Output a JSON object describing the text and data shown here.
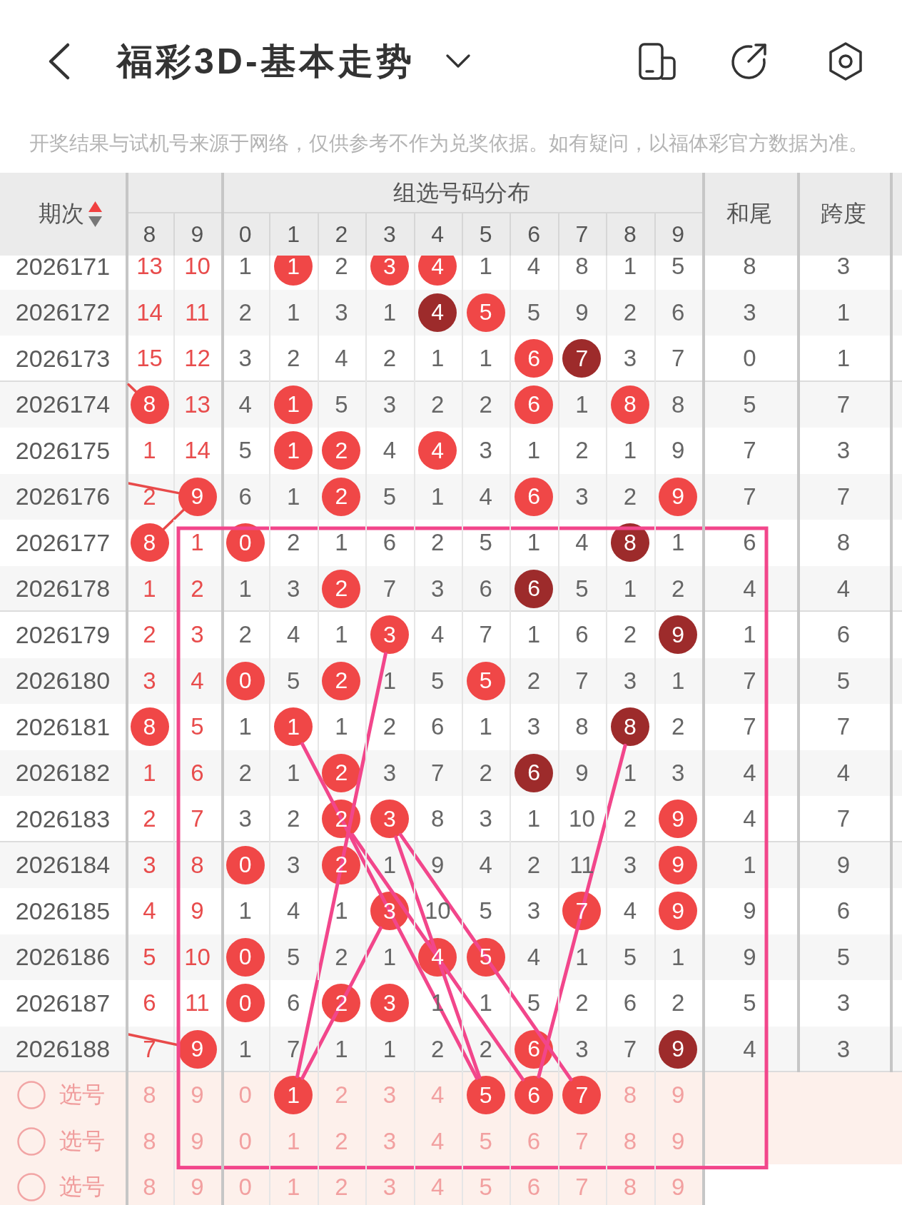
{
  "top_bar": {
    "title": "福彩3D-基本走势"
  },
  "notice": "开奖结果与试机号来源于网络，仅供参考不作为兑奖依据。如有疑问，以福体彩官方数据为准。",
  "table": {
    "period_header": "期次",
    "sort_ascending": true,
    "group_header": "组选号码分布",
    "sum_tail_header": "和尾",
    "span_header": "跨度",
    "digit_headers": [
      "8",
      "9",
      "0",
      "1",
      "2",
      "3",
      "4",
      "5",
      "6",
      "7",
      "8",
      "9"
    ],
    "rows": [
      {
        "period": "2026171",
        "cells": [
          {
            "value": "13",
            "kind": "plain"
          },
          {
            "value": "10",
            "kind": "plain"
          },
          {
            "value": "1",
            "kind": "plain"
          },
          {
            "value": "1",
            "kind": "ball"
          },
          {
            "value": "2",
            "kind": "plain"
          },
          {
            "value": "3",
            "kind": "ball"
          },
          {
            "value": "4",
            "kind": "ball"
          },
          {
            "value": "1",
            "kind": "plain"
          },
          {
            "value": "4",
            "kind": "plain"
          },
          {
            "value": "8",
            "kind": "plain"
          },
          {
            "value": "1",
            "kind": "plain"
          },
          {
            "value": "5",
            "kind": "plain"
          }
        ],
        "sum_tail": "8",
        "span": "3"
      },
      {
        "period": "2026172",
        "cells": [
          {
            "value": "14",
            "kind": "plain"
          },
          {
            "value": "11",
            "kind": "plain"
          },
          {
            "value": "2",
            "kind": "plain"
          },
          {
            "value": "1",
            "kind": "plain"
          },
          {
            "value": "3",
            "kind": "plain"
          },
          {
            "value": "1",
            "kind": "plain"
          },
          {
            "value": "4",
            "kind": "pair"
          },
          {
            "value": "5",
            "kind": "ball"
          },
          {
            "value": "5",
            "kind": "plain"
          },
          {
            "value": "9",
            "kind": "plain"
          },
          {
            "value": "2",
            "kind": "plain"
          },
          {
            "value": "6",
            "kind": "plain"
          }
        ],
        "sum_tail": "3",
        "span": "1"
      },
      {
        "period": "2026173",
        "cells": [
          {
            "value": "15",
            "kind": "plain"
          },
          {
            "value": "12",
            "kind": "plain"
          },
          {
            "value": "3",
            "kind": "plain"
          },
          {
            "value": "2",
            "kind": "plain"
          },
          {
            "value": "4",
            "kind": "plain"
          },
          {
            "value": "2",
            "kind": "plain"
          },
          {
            "value": "1",
            "kind": "plain"
          },
          {
            "value": "1",
            "kind": "plain"
          },
          {
            "value": "6",
            "kind": "ball"
          },
          {
            "value": "7",
            "kind": "pair"
          },
          {
            "value": "3",
            "kind": "plain"
          },
          {
            "value": "7",
            "kind": "plain"
          }
        ],
        "sum_tail": "0",
        "span": "1"
      },
      {
        "period": "2026174",
        "cells": [
          {
            "value": "8",
            "kind": "ball"
          },
          {
            "value": "13",
            "kind": "plain"
          },
          {
            "value": "4",
            "kind": "plain"
          },
          {
            "value": "1",
            "kind": "ball"
          },
          {
            "value": "5",
            "kind": "plain"
          },
          {
            "value": "3",
            "kind": "plain"
          },
          {
            "value": "2",
            "kind": "plain"
          },
          {
            "value": "2",
            "kind": "plain"
          },
          {
            "value": "6",
            "kind": "ball"
          },
          {
            "value": "1",
            "kind": "plain"
          },
          {
            "value": "8",
            "kind": "ball"
          },
          {
            "value": "8",
            "kind": "plain"
          }
        ],
        "sum_tail": "5",
        "span": "7"
      },
      {
        "period": "2026175",
        "cells": [
          {
            "value": "1",
            "kind": "plain"
          },
          {
            "value": "14",
            "kind": "plain"
          },
          {
            "value": "5",
            "kind": "plain"
          },
          {
            "value": "1",
            "kind": "ball"
          },
          {
            "value": "2",
            "kind": "ball"
          },
          {
            "value": "4",
            "kind": "plain"
          },
          {
            "value": "4",
            "kind": "ball"
          },
          {
            "value": "3",
            "kind": "plain"
          },
          {
            "value": "1",
            "kind": "plain"
          },
          {
            "value": "2",
            "kind": "plain"
          },
          {
            "value": "1",
            "kind": "plain"
          },
          {
            "value": "9",
            "kind": "plain"
          }
        ],
        "sum_tail": "7",
        "span": "3"
      },
      {
        "period": "2026176",
        "cells": [
          {
            "value": "2",
            "kind": "plain"
          },
          {
            "value": "9",
            "kind": "ball"
          },
          {
            "value": "6",
            "kind": "plain"
          },
          {
            "value": "1",
            "kind": "plain"
          },
          {
            "value": "2",
            "kind": "ball"
          },
          {
            "value": "5",
            "kind": "plain"
          },
          {
            "value": "1",
            "kind": "plain"
          },
          {
            "value": "4",
            "kind": "plain"
          },
          {
            "value": "6",
            "kind": "ball"
          },
          {
            "value": "3",
            "kind": "plain"
          },
          {
            "value": "2",
            "kind": "plain"
          },
          {
            "value": "9",
            "kind": "ball"
          }
        ],
        "sum_tail": "7",
        "span": "7"
      },
      {
        "period": "2026177",
        "cells": [
          {
            "value": "8",
            "kind": "ball"
          },
          {
            "value": "1",
            "kind": "plain"
          },
          {
            "value": "0",
            "kind": "ball"
          },
          {
            "value": "2",
            "kind": "plain"
          },
          {
            "value": "1",
            "kind": "plain"
          },
          {
            "value": "6",
            "kind": "plain"
          },
          {
            "value": "2",
            "kind": "plain"
          },
          {
            "value": "5",
            "kind": "plain"
          },
          {
            "value": "1",
            "kind": "plain"
          },
          {
            "value": "4",
            "kind": "plain"
          },
          {
            "value": "8",
            "kind": "pair"
          },
          {
            "value": "1",
            "kind": "plain"
          }
        ],
        "sum_tail": "6",
        "span": "8"
      },
      {
        "period": "2026178",
        "cells": [
          {
            "value": "1",
            "kind": "plain"
          },
          {
            "value": "2",
            "kind": "plain"
          },
          {
            "value": "1",
            "kind": "plain"
          },
          {
            "value": "3",
            "kind": "plain"
          },
          {
            "value": "2",
            "kind": "ball"
          },
          {
            "value": "7",
            "kind": "plain"
          },
          {
            "value": "3",
            "kind": "plain"
          },
          {
            "value": "6",
            "kind": "plain"
          },
          {
            "value": "6",
            "kind": "pair"
          },
          {
            "value": "5",
            "kind": "plain"
          },
          {
            "value": "1",
            "kind": "plain"
          },
          {
            "value": "2",
            "kind": "plain"
          }
        ],
        "sum_tail": "4",
        "span": "4"
      },
      {
        "period": "2026179",
        "cells": [
          {
            "value": "2",
            "kind": "plain"
          },
          {
            "value": "3",
            "kind": "plain"
          },
          {
            "value": "2",
            "kind": "plain"
          },
          {
            "value": "4",
            "kind": "plain"
          },
          {
            "value": "1",
            "kind": "plain"
          },
          {
            "value": "3",
            "kind": "ball"
          },
          {
            "value": "4",
            "kind": "plain"
          },
          {
            "value": "7",
            "kind": "plain"
          },
          {
            "value": "1",
            "kind": "plain"
          },
          {
            "value": "6",
            "kind": "plain"
          },
          {
            "value": "2",
            "kind": "plain"
          },
          {
            "value": "9",
            "kind": "pair"
          }
        ],
        "sum_tail": "1",
        "span": "6"
      },
      {
        "period": "2026180",
        "cells": [
          {
            "value": "3",
            "kind": "plain"
          },
          {
            "value": "4",
            "kind": "plain"
          },
          {
            "value": "0",
            "kind": "ball"
          },
          {
            "value": "5",
            "kind": "plain"
          },
          {
            "value": "2",
            "kind": "ball"
          },
          {
            "value": "1",
            "kind": "plain"
          },
          {
            "value": "5",
            "kind": "plain"
          },
          {
            "value": "5",
            "kind": "ball"
          },
          {
            "value": "2",
            "kind": "plain"
          },
          {
            "value": "7",
            "kind": "plain"
          },
          {
            "value": "3",
            "kind": "plain"
          },
          {
            "value": "1",
            "kind": "plain"
          }
        ],
        "sum_tail": "7",
        "span": "5"
      },
      {
        "period": "2026181",
        "cells": [
          {
            "value": "8",
            "kind": "ball"
          },
          {
            "value": "5",
            "kind": "plain"
          },
          {
            "value": "1",
            "kind": "plain"
          },
          {
            "value": "1",
            "kind": "ball"
          },
          {
            "value": "1",
            "kind": "plain"
          },
          {
            "value": "2",
            "kind": "plain"
          },
          {
            "value": "6",
            "kind": "plain"
          },
          {
            "value": "1",
            "kind": "plain"
          },
          {
            "value": "3",
            "kind": "plain"
          },
          {
            "value": "8",
            "kind": "plain"
          },
          {
            "value": "8",
            "kind": "pair"
          },
          {
            "value": "2",
            "kind": "plain"
          }
        ],
        "sum_tail": "7",
        "span": "7"
      },
      {
        "period": "2026182",
        "cells": [
          {
            "value": "1",
            "kind": "plain"
          },
          {
            "value": "6",
            "kind": "plain"
          },
          {
            "value": "2",
            "kind": "plain"
          },
          {
            "value": "1",
            "kind": "plain"
          },
          {
            "value": "2",
            "kind": "ball"
          },
          {
            "value": "3",
            "kind": "plain"
          },
          {
            "value": "7",
            "kind": "plain"
          },
          {
            "value": "2",
            "kind": "plain"
          },
          {
            "value": "6",
            "kind": "pair"
          },
          {
            "value": "9",
            "kind": "plain"
          },
          {
            "value": "1",
            "kind": "plain"
          },
          {
            "value": "3",
            "kind": "plain"
          }
        ],
        "sum_tail": "4",
        "span": "4"
      },
      {
        "period": "2026183",
        "cells": [
          {
            "value": "2",
            "kind": "plain"
          },
          {
            "value": "7",
            "kind": "plain"
          },
          {
            "value": "3",
            "kind": "plain"
          },
          {
            "value": "2",
            "kind": "plain"
          },
          {
            "value": "2",
            "kind": "ball"
          },
          {
            "value": "3",
            "kind": "ball"
          },
          {
            "value": "8",
            "kind": "plain"
          },
          {
            "value": "3",
            "kind": "plain"
          },
          {
            "value": "1",
            "kind": "plain"
          },
          {
            "value": "10",
            "kind": "plain"
          },
          {
            "value": "2",
            "kind": "plain"
          },
          {
            "value": "9",
            "kind": "ball"
          }
        ],
        "sum_tail": "4",
        "span": "7"
      },
      {
        "period": "2026184",
        "cells": [
          {
            "value": "3",
            "kind": "plain"
          },
          {
            "value": "8",
            "kind": "plain"
          },
          {
            "value": "0",
            "kind": "ball"
          },
          {
            "value": "3",
            "kind": "plain"
          },
          {
            "value": "2",
            "kind": "ball"
          },
          {
            "value": "1",
            "kind": "plain"
          },
          {
            "value": "9",
            "kind": "plain"
          },
          {
            "value": "4",
            "kind": "plain"
          },
          {
            "value": "2",
            "kind": "plain"
          },
          {
            "value": "11",
            "kind": "plain"
          },
          {
            "value": "3",
            "kind": "plain"
          },
          {
            "value": "9",
            "kind": "ball"
          }
        ],
        "sum_tail": "1",
        "span": "9"
      },
      {
        "period": "2026185",
        "cells": [
          {
            "value": "4",
            "kind": "plain"
          },
          {
            "value": "9",
            "kind": "plain"
          },
          {
            "value": "1",
            "kind": "plain"
          },
          {
            "value": "4",
            "kind": "plain"
          },
          {
            "value": "1",
            "kind": "plain"
          },
          {
            "value": "3",
            "kind": "ball"
          },
          {
            "value": "10",
            "kind": "plain"
          },
          {
            "value": "5",
            "kind": "plain"
          },
          {
            "value": "3",
            "kind": "plain"
          },
          {
            "value": "7",
            "kind": "ball"
          },
          {
            "value": "4",
            "kind": "plain"
          },
          {
            "value": "9",
            "kind": "ball"
          }
        ],
        "sum_tail": "9",
        "span": "6"
      },
      {
        "period": "2026186",
        "cells": [
          {
            "value": "5",
            "kind": "plain"
          },
          {
            "value": "10",
            "kind": "plain"
          },
          {
            "value": "0",
            "kind": "ball"
          },
          {
            "value": "5",
            "kind": "plain"
          },
          {
            "value": "2",
            "kind": "plain"
          },
          {
            "value": "1",
            "kind": "plain"
          },
          {
            "value": "4",
            "kind": "ball"
          },
          {
            "value": "5",
            "kind": "ball"
          },
          {
            "value": "4",
            "kind": "plain"
          },
          {
            "value": "1",
            "kind": "plain"
          },
          {
            "value": "5",
            "kind": "plain"
          },
          {
            "value": "1",
            "kind": "plain"
          }
        ],
        "sum_tail": "9",
        "span": "5"
      },
      {
        "period": "2026187",
        "cells": [
          {
            "value": "6",
            "kind": "plain"
          },
          {
            "value": "11",
            "kind": "plain"
          },
          {
            "value": "0",
            "kind": "ball"
          },
          {
            "value": "6",
            "kind": "plain"
          },
          {
            "value": "2",
            "kind": "ball"
          },
          {
            "value": "3",
            "kind": "ball"
          },
          {
            "value": "1",
            "kind": "plain"
          },
          {
            "value": "1",
            "kind": "plain"
          },
          {
            "value": "5",
            "kind": "plain"
          },
          {
            "value": "2",
            "kind": "plain"
          },
          {
            "value": "6",
            "kind": "plain"
          },
          {
            "value": "2",
            "kind": "plain"
          }
        ],
        "sum_tail": "5",
        "span": "3"
      },
      {
        "period": "2026188",
        "cells": [
          {
            "value": "7",
            "kind": "plain"
          },
          {
            "value": "9",
            "kind": "ball"
          },
          {
            "value": "1",
            "kind": "plain"
          },
          {
            "value": "7",
            "kind": "plain"
          },
          {
            "value": "1",
            "kind": "plain"
          },
          {
            "value": "1",
            "kind": "plain"
          },
          {
            "value": "2",
            "kind": "plain"
          },
          {
            "value": "2",
            "kind": "plain"
          },
          {
            "value": "6",
            "kind": "ball"
          },
          {
            "value": "3",
            "kind": "plain"
          },
          {
            "value": "7",
            "kind": "plain"
          },
          {
            "value": "9",
            "kind": "pair"
          }
        ],
        "sum_tail": "4",
        "span": "3"
      }
    ],
    "pick_rows": [
      {
        "label": "选号",
        "selected": false,
        "cells": [
          {
            "value": "8",
            "selected": false
          },
          {
            "value": "9",
            "selected": false
          },
          {
            "value": "0",
            "selected": false
          },
          {
            "value": "1",
            "selected": true
          },
          {
            "value": "2",
            "selected": false
          },
          {
            "value": "3",
            "selected": false
          },
          {
            "value": "4",
            "selected": false
          },
          {
            "value": "5",
            "selected": true
          },
          {
            "value": "6",
            "selected": true
          },
          {
            "value": "7",
            "selected": true
          },
          {
            "value": "8",
            "selected": false
          },
          {
            "value": "9",
            "selected": false
          }
        ]
      },
      {
        "label": "选号",
        "selected": false,
        "cells": [
          {
            "value": "8",
            "selected": false
          },
          {
            "value": "9",
            "selected": false
          },
          {
            "value": "0",
            "selected": false
          },
          {
            "value": "1",
            "selected": false
          },
          {
            "value": "2",
            "selected": false
          },
          {
            "value": "3",
            "selected": false
          },
          {
            "value": "4",
            "selected": false
          },
          {
            "value": "5",
            "selected": false
          },
          {
            "value": "6",
            "selected": false
          },
          {
            "value": "7",
            "selected": false
          },
          {
            "value": "8",
            "selected": false
          },
          {
            "value": "9",
            "selected": false
          }
        ]
      },
      {
        "label": "选号",
        "selected": false,
        "cells": [
          {
            "value": "8",
            "selected": false
          },
          {
            "value": "9",
            "selected": false
          },
          {
            "value": "0",
            "selected": false
          },
          {
            "value": "1",
            "selected": false
          },
          {
            "value": "2",
            "selected": false
          },
          {
            "value": "3",
            "selected": false
          },
          {
            "value": "4",
            "selected": false
          },
          {
            "value": "5",
            "selected": false
          },
          {
            "value": "6",
            "selected": false
          },
          {
            "value": "7",
            "selected": false
          },
          {
            "value": "8",
            "selected": false
          },
          {
            "value": "9",
            "selected": false
          }
        ]
      }
    ]
  }
}
